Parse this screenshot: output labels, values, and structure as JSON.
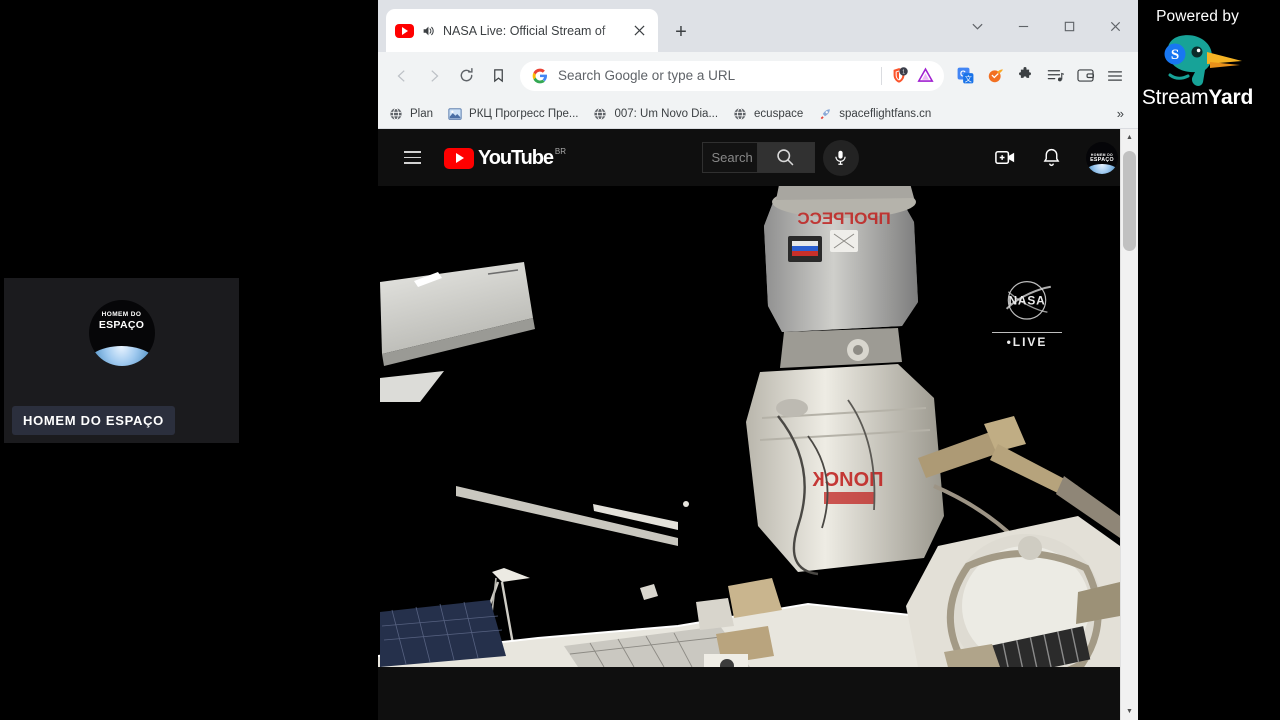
{
  "streamyard": {
    "watermark_prefix": "Powered by",
    "brand_first": "Stream",
    "brand_second": "Yard",
    "participant": {
      "name_label": "HOMEM DO ESPAÇO",
      "avatar_line1": "HOMEM DO",
      "avatar_line2": "ESPAÇO"
    }
  },
  "browser": {
    "tab": {
      "title": "NASA Live: Official Stream of ",
      "favicon": "youtube-icon",
      "audio_icon": "speaker-playing-icon",
      "close_icon": "close-icon"
    },
    "new_tab_label": "+",
    "window_controls": [
      {
        "name": "tab-search-button",
        "icon": "chevron-down-icon",
        "glyph": "⌄"
      },
      {
        "name": "minimize-button",
        "icon": "minimize-icon",
        "glyph": "—"
      },
      {
        "name": "maximize-button",
        "icon": "maximize-icon",
        "glyph": "▢"
      },
      {
        "name": "close-window-button",
        "icon": "close-icon",
        "glyph": "✕"
      }
    ],
    "toolbar": {
      "back_label": "◁",
      "forward_label": "▷",
      "reload_label": "C",
      "bookmark_label": "🔖",
      "omnibox_placeholder": "Search Google or type a URL",
      "omnibox_value": "",
      "search_engine_icon": "google-g-icon",
      "inline_icons": [
        "brave-shields-icon",
        "brave-rewards-icon"
      ],
      "extension_icons": [
        "google-translate-icon",
        "honey-extension-icon",
        "puzzle-extensions-icon",
        "playlist-icon",
        "wallet-icon",
        "brave-menu-icon"
      ]
    },
    "bookmarks": {
      "items": [
        {
          "label": "Plan",
          "icon": "globe-icon"
        },
        {
          "label": "РКЦ Прогресс Пре...",
          "icon": "image-favicon"
        },
        {
          "label": "007: Um Novo Dia...",
          "icon": "globe-icon"
        },
        {
          "label": "ecuspace",
          "icon": "globe-icon"
        },
        {
          "label": "spaceflightfans.cn",
          "icon": "rocket-favicon"
        }
      ],
      "overflow_label": "»"
    },
    "scrollbar": {
      "up_arrow": "▲",
      "down_arrow": "▼"
    }
  },
  "youtube": {
    "menu_icon": "hamburger-menu-icon",
    "logo_text": "YouTube",
    "country_code": "BR",
    "search_placeholder": "Search",
    "search_button_icon": "search-icon",
    "mic_icon": "microphone-icon",
    "create_icon": "create-video-icon",
    "notifications_icon": "bell-icon",
    "avatar_line1": "HOMEM DO",
    "avatar_line2": "ESPAÇO",
    "video": {
      "overlay_brand": "NASA",
      "overlay_live": "•LIVE",
      "caption_text_1": "ПРОГРЕСС",
      "caption_text_2": "ПОИСК"
    }
  },
  "colors": {
    "youtube_red": "#ff0000",
    "yt_background": "#0f0f0f",
    "chrome_tabstrip": "#dee1e6",
    "chrome_toolbar": "#f1f3f4",
    "streamyard_teal": "#17a398",
    "streamyard_beak": "#f5a623",
    "name_label_bg": "#2e3242"
  }
}
